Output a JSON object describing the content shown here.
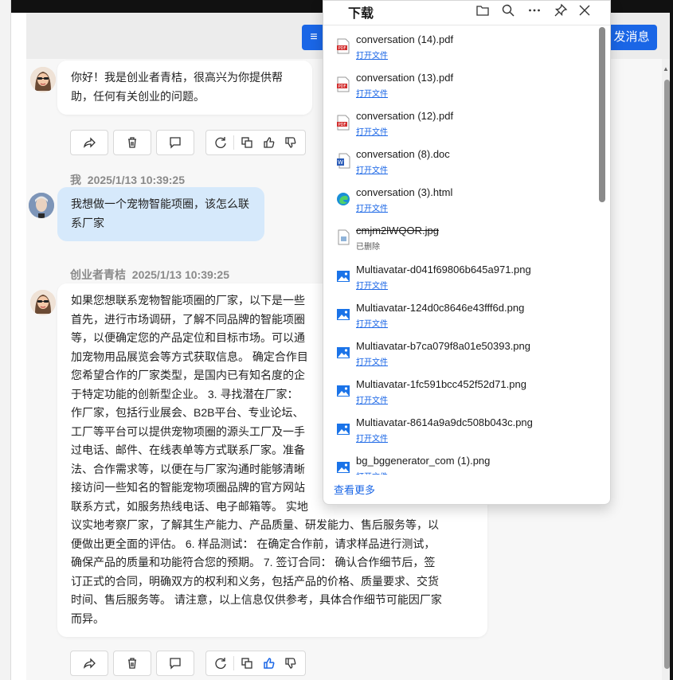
{
  "header": {
    "menu_label": "≡",
    "send_label": "发消息"
  },
  "messages": [
    {
      "role": "bot",
      "text": "你好！我是创业者青桔，很高兴为你提供帮助，任何有关创业的问题。"
    },
    {
      "role": "user",
      "sender": "我",
      "time": "2025/1/13 10:39:25",
      "text": "我想做一个宠物智能项圈，该怎么联系厂家"
    },
    {
      "role": "bot",
      "sender": "创业者青桔",
      "time": "2025/1/13 10:39:25",
      "lines": [
        "如果您想联系宠物智能项圈的厂家，以下是一些",
        "首先，进行市场调研，了解不同品牌的智能项圈",
        "等，以便确定您的产品定位和目标市场。可以通",
        "加宠物用品展览会等方式获取信息。 确定合作目",
        "您希望合作的厂家类型，是国内已有知名度的企",
        "于特定功能的创新型企业。 3. 寻找潜在厂家：",
        "作厂家，包括行业展会、B2B平台、专业论坛、",
        "工厂等平台可以提供宠物项圈的源头工厂及一手",
        "过电话、邮件、在线表单等方式联系厂家。准备",
        "法、合作需求等，以便在与厂家沟通时能够清晰",
        "接访问一些知名的智能宠物项圈品牌的官方网站",
        "联系方式，如服务热线电话、电子邮箱等。 实地",
        "议实地考察厂家，了解其生产能力、产品质量、研发能力、售后服务等，以",
        "便做出更全面的评估。 6. 样品测试： 在确定合作前，请求样品进行测试，",
        "确保产品的质量和功能符合您的预期。 7. 签订合同： 确认合作细节后，签",
        "订正式的合同，明确双方的权利和义务，包括产品的价格、质量要求、交货",
        "时间、售后服务等。 请注意，以上信息仅供参考，具体合作细节可能因厂家",
        "而异。"
      ]
    }
  ],
  "downloads": {
    "title": "下载",
    "tools": [
      "folder-icon",
      "search-icon",
      "more-icon",
      "pin-icon",
      "close-icon"
    ],
    "items": [
      {
        "name": "conversation (14).pdf",
        "action": "打开文件",
        "type": "pdf"
      },
      {
        "name": "conversation (13).pdf",
        "action": "打开文件",
        "type": "pdf"
      },
      {
        "name": "conversation (12).pdf",
        "action": "打开文件",
        "type": "pdf"
      },
      {
        "name": "conversation (8).doc",
        "action": "打开文件",
        "type": "doc"
      },
      {
        "name": "conversation (3).html",
        "action": "打开文件",
        "type": "html"
      },
      {
        "name": "cmjm2lWQOR.jpg",
        "action": "已删除",
        "type": "deleted"
      },
      {
        "name": "Multiavatar-d041f69806b645a971.png",
        "action": "打开文件",
        "type": "png"
      },
      {
        "name": "Multiavatar-124d0c8646e43fff6d.png",
        "action": "打开文件",
        "type": "png"
      },
      {
        "name": "Multiavatar-b7ca079f8a01e50393.png",
        "action": "打开文件",
        "type": "png"
      },
      {
        "name": "Multiavatar-1fc591bcc452f52d71.png",
        "action": "打开文件",
        "type": "png"
      },
      {
        "name": "Multiavatar-8614a9a9dc508b043c.png",
        "action": "打开文件",
        "type": "png"
      },
      {
        "name": "bg_bggenerator_com (1).png",
        "action": "打开文件",
        "type": "png"
      }
    ],
    "more_label": "查看更多"
  },
  "colors": {
    "accent": "#1a66e6",
    "user_bubble": "#d6e9fb",
    "bot_bubble": "#ffffff"
  }
}
